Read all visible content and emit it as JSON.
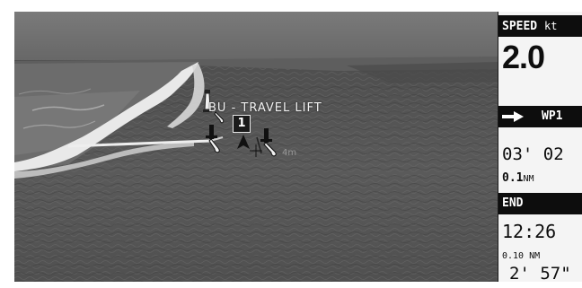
{
  "chart_view": {
    "label": "BU - TRAVEL LIFT",
    "waypoint_marker": "1",
    "depth_label": "4m",
    "icons": [
      "marina-hoist-icon",
      "marina-hoist-icon",
      "marina-hoist-icon",
      "lighthouse-icon",
      "boat-position-icon"
    ],
    "colors": {
      "sky": "#6f6f6f",
      "sea": "#555555",
      "shore": "#e8e8e8"
    }
  },
  "panel": {
    "speed": {
      "label": "SPEED",
      "unit": "kt",
      "value": "2.0"
    },
    "waypoint": {
      "icon": "right-arrow-icon",
      "name": "WP1",
      "time_to_go": "03' 02",
      "distance": "0.1",
      "distance_unit": "NM"
    },
    "end": {
      "label": "END",
      "eta": "12:26",
      "distance": "0.10 NM",
      "time_to_go": "2' 57\""
    }
  }
}
